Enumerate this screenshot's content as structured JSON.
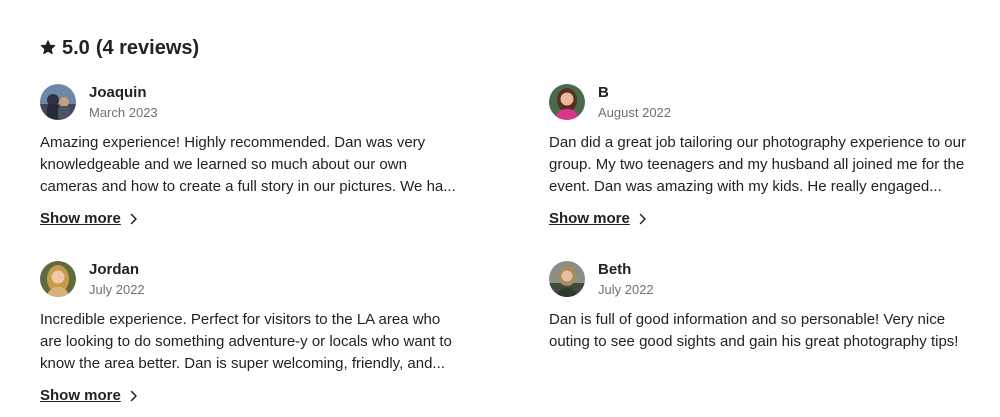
{
  "reviews_summary": {
    "rating": "5.0",
    "count_label": "(4 reviews)",
    "icon": "star-icon"
  },
  "reviews": [
    {
      "name": "Joaquin",
      "date": "March 2023",
      "text": "Amazing experience! Highly recommended. Dan was very knowledgeable and we learned so much about our own cameras and how to create a full story in our pictures. We ha...",
      "show_more": "Show more"
    },
    {
      "name": "B",
      "date": "August 2022",
      "text": "Dan did a great job tailoring our photography experience to our group. My two teenagers and my husband all joined me for the event. Dan was amazing with my kids. He really engaged...",
      "show_more": "Show more"
    },
    {
      "name": "Jordan",
      "date": "July 2022",
      "text": "Incredible experience. Perfect for visitors to the LA area who are looking to do something adventure-y or locals who want to know the area better. Dan is super welcoming, friendly, and...",
      "show_more": "Show more"
    },
    {
      "name": "Beth",
      "date": "July 2022",
      "text": "Dan is full of good information and so personable! Very nice outing to see good sights and gain his great photography tips!"
    }
  ],
  "colors": {
    "text_primary": "#222222",
    "text_secondary": "#717171",
    "background": "#ffffff"
  }
}
